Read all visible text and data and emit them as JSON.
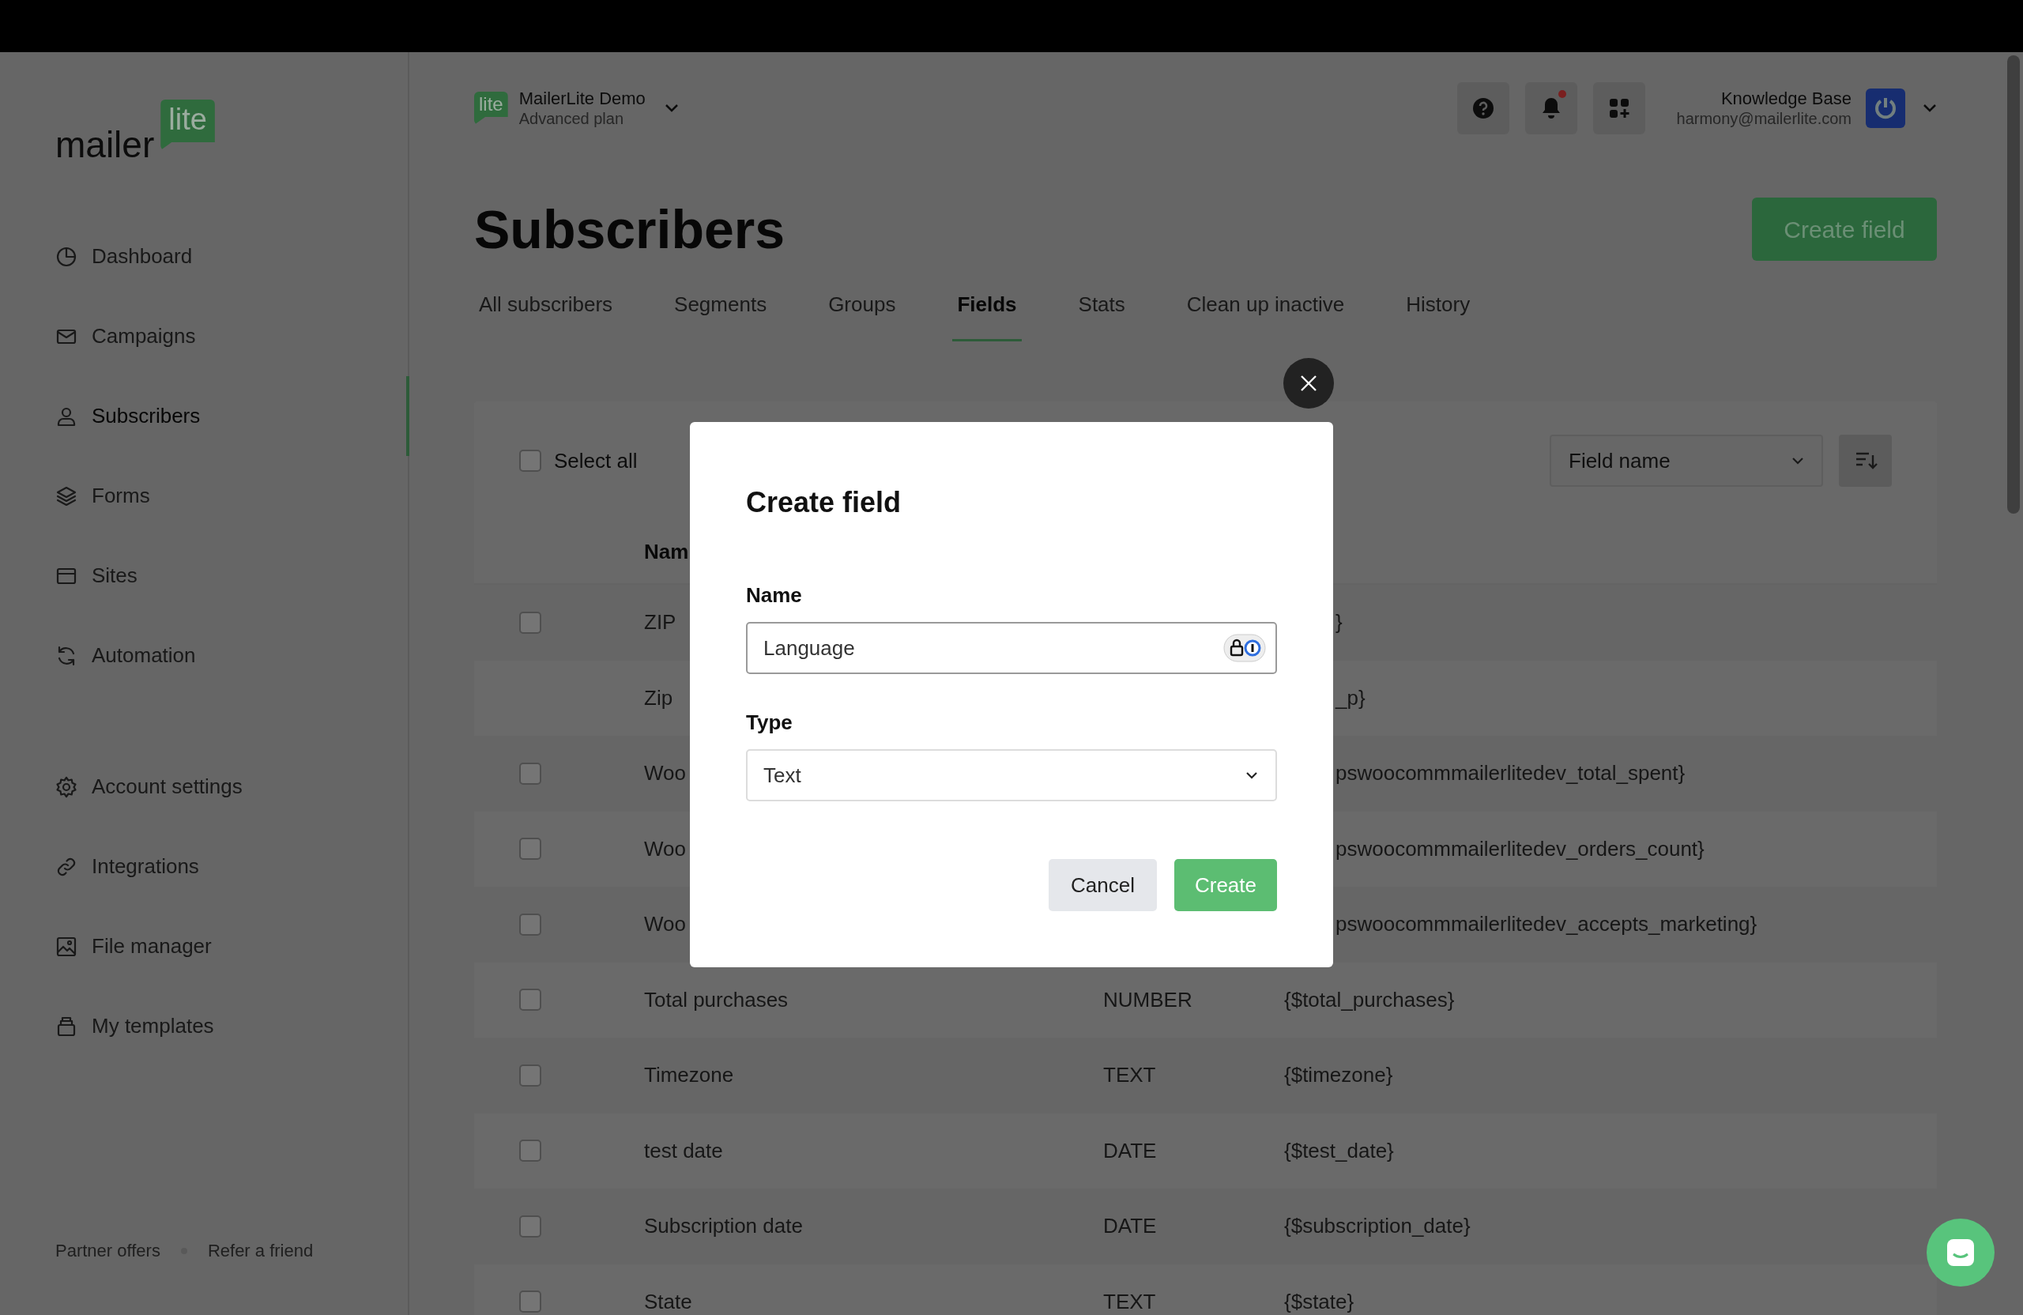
{
  "logo": {
    "word": "mailer",
    "badge": "lite"
  },
  "sidebar": {
    "primary_items": [
      {
        "label": "Dashboard",
        "selected": false
      },
      {
        "label": "Campaigns",
        "selected": false
      },
      {
        "label": "Subscribers",
        "selected": true
      },
      {
        "label": "Forms",
        "selected": false
      },
      {
        "label": "Sites",
        "selected": false
      },
      {
        "label": "Automation",
        "selected": false
      }
    ],
    "secondary_items": [
      {
        "label": "Account settings",
        "selected": false
      },
      {
        "label": "Integrations",
        "selected": false
      },
      {
        "label": "File manager",
        "selected": false
      },
      {
        "label": "My templates",
        "selected": false
      }
    ],
    "footer_links": [
      "Partner offers",
      "Refer a friend"
    ]
  },
  "account": {
    "badge": "lite",
    "name": "MailerLite Demo",
    "plan": "Advanced plan"
  },
  "notifications": {
    "unread": true
  },
  "user": {
    "name": "Knowledge Base",
    "email": "harmony@mailerlite.com"
  },
  "page": {
    "title": "Subscribers",
    "action": "Create field"
  },
  "tabs": [
    {
      "label": "All subscribers",
      "selected": false
    },
    {
      "label": "Segments",
      "selected": false
    },
    {
      "label": "Groups",
      "selected": false
    },
    {
      "label": "Fields",
      "selected": true
    },
    {
      "label": "Stats",
      "selected": false
    },
    {
      "label": "Clean up inactive",
      "selected": false
    },
    {
      "label": "History",
      "selected": false
    }
  ],
  "table": {
    "select_all": {
      "label": "Select all",
      "checked": false
    },
    "sort_by": {
      "value": "Field name"
    },
    "columns": [
      "Nam"
    ],
    "rows": [
      {
        "name": "ZIP",
        "tag": "}",
        "checked": false
      },
      {
        "name": "Zip",
        "tag": "_p}"
      },
      {
        "name": "Woo",
        "tag": "pswoocommmailerlitedev_total_spent}",
        "checked": false
      },
      {
        "name": "Woo",
        "tag": "pswoocommmailerlitedev_orders_count}",
        "checked": false
      },
      {
        "name": "Woo",
        "tag": "pswoocommmailerlitedev_accepts_marketing}",
        "checked": false
      },
      {
        "name": "Total purchases",
        "type": "NUMBER",
        "tag": "{$total_purchases}",
        "checked": false
      },
      {
        "name": "Timezone",
        "type": "TEXT",
        "tag": "{$timezone}",
        "checked": false
      },
      {
        "name": "test date",
        "type": "DATE",
        "tag": "{$test_date}",
        "checked": false
      },
      {
        "name": "Subscription date",
        "type": "DATE",
        "tag": "{$subscription_date}",
        "checked": false
      },
      {
        "name": "State",
        "type": "TEXT",
        "tag": "{$state}",
        "checked": false
      }
    ]
  },
  "dialog": {
    "title": "Create field",
    "fields": [
      {
        "kind": "text",
        "label": "Name",
        "value": "Language"
      },
      {
        "kind": "select",
        "label": "Type",
        "value": "Text"
      }
    ],
    "buttons": [
      {
        "kind": "secondary",
        "label": "Cancel"
      },
      {
        "kind": "primary",
        "label": "Create"
      }
    ]
  }
}
